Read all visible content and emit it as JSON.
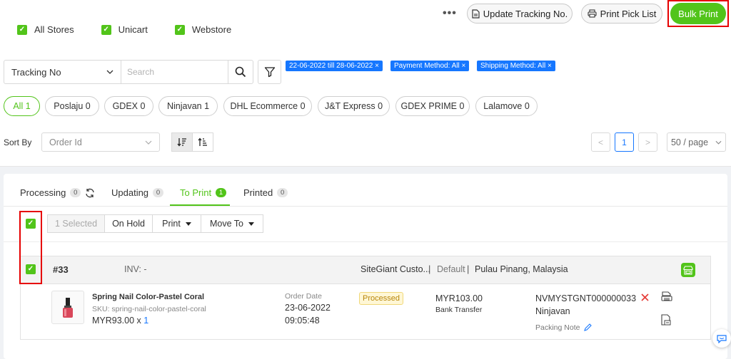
{
  "toolbar": {
    "more_label": "•••",
    "update_tracking": "Update Tracking No.",
    "print_pick_list": "Print Pick List",
    "bulk_print": "Bulk Print"
  },
  "stores": [
    {
      "label": "All Stores",
      "checked": true
    },
    {
      "label": "Unicart",
      "checked": true
    },
    {
      "label": "Webstore",
      "checked": true
    }
  ],
  "search": {
    "field_select": "Tracking No",
    "placeholder": "Search"
  },
  "filter_tags": [
    "22-06-2022 till 28-06-2022 ×",
    "Payment Method: All ×",
    "Shipping Method: All ×"
  ],
  "couriers": [
    {
      "label": "All 1",
      "active": true
    },
    {
      "label": "Poslaju 0",
      "active": false
    },
    {
      "label": "GDEX 0",
      "active": false
    },
    {
      "label": "Ninjavan 1",
      "active": false
    },
    {
      "label": "DHL Ecommerce 0",
      "active": false
    },
    {
      "label": "J&T Express 0",
      "active": false
    },
    {
      "label": "GDEX PRIME 0",
      "active": false
    },
    {
      "label": "Lalamove 0",
      "active": false
    }
  ],
  "sort": {
    "label": "Sort By",
    "value": "Order Id"
  },
  "pagination": {
    "prev": "<",
    "current": "1",
    "next": ">",
    "per_page": "50 / page"
  },
  "tabs": [
    {
      "label": "Processing",
      "count": "0"
    },
    {
      "label": "Updating",
      "count": "0"
    },
    {
      "label": "To Print",
      "count": "1"
    },
    {
      "label": "Printed",
      "count": "0"
    }
  ],
  "actions": {
    "selected": "1 Selected",
    "on_hold": "On Hold",
    "print": "Print",
    "move_to": "Move To"
  },
  "order": {
    "id": "#33",
    "invoice": "INV: -",
    "customer": "SiteGiant Custo...",
    "sep1": "|",
    "address_type": "Default",
    "sep2": "|",
    "location": "Pulau Pinang, Malaysia",
    "product_name": "Spring Nail Color-Pastel Coral",
    "sku": "SKU: spring-nail-color-pastel-coral",
    "price": "MYR93.00 x",
    "qty": "1",
    "date_label": "Order Date",
    "date": "23-06-2022",
    "time": "09:05:48",
    "status": "Processed",
    "amount": "MYR103.00",
    "payment": "Bank Transfer",
    "tracking_no": "NVMYSTGNT000000033",
    "courier": "Ninjavan",
    "packing_note": "Packing Note"
  },
  "colors": {
    "accent_green": "#52c41a",
    "tag_blue": "#1677ff",
    "highlight_red": "#e60000",
    "cancel_red": "#e53935"
  }
}
